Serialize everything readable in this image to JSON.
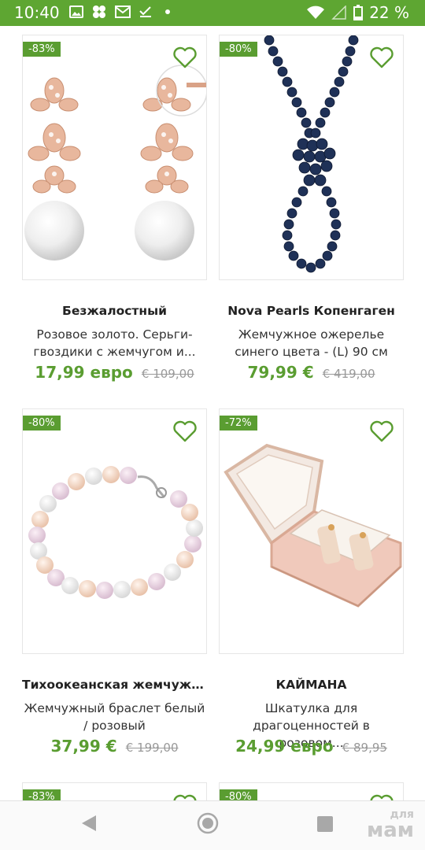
{
  "status_bar": {
    "time": "10:40",
    "battery": "22 %"
  },
  "products": [
    {
      "discount": "-83%",
      "brand": "Безжалостный",
      "desc_line1": "Розовое золото. Серьги-",
      "desc_line2": "гвоздики с жемчугом и...",
      "price": "17,99 евро",
      "old_price": "€ 109,00",
      "image": "pearl-earrings"
    },
    {
      "discount": "-80%",
      "brand": "Nova Pearls Копенгаген",
      "desc_line1": "Жемчужное ожерелье",
      "desc_line2": "синего цвета - (L) 90 см",
      "price": "79,99 €",
      "old_price": "€ 419,00",
      "image": "blue-pearl-necklace"
    },
    {
      "discount": "-80%",
      "brand": "Тихоокеанская жемчужна...",
      "desc_line1": "Жемчужный браслет белый",
      "desc_line2": "/ розовый",
      "price": "37,99 €",
      "old_price": "€ 199,00",
      "image": "pearl-bracelet"
    },
    {
      "discount": "-72%",
      "brand": "КАЙМАНА",
      "desc_line1": "Шкатулка для",
      "desc_line2": "драгоценностей в розовом...",
      "price": "24,99 евро",
      "old_price": "€ 89,95",
      "image": "jewelry-box"
    },
    {
      "discount": "-83%"
    },
    {
      "discount": "-80%"
    }
  ],
  "watermark": {
    "line1": "для",
    "line2": "мам"
  }
}
